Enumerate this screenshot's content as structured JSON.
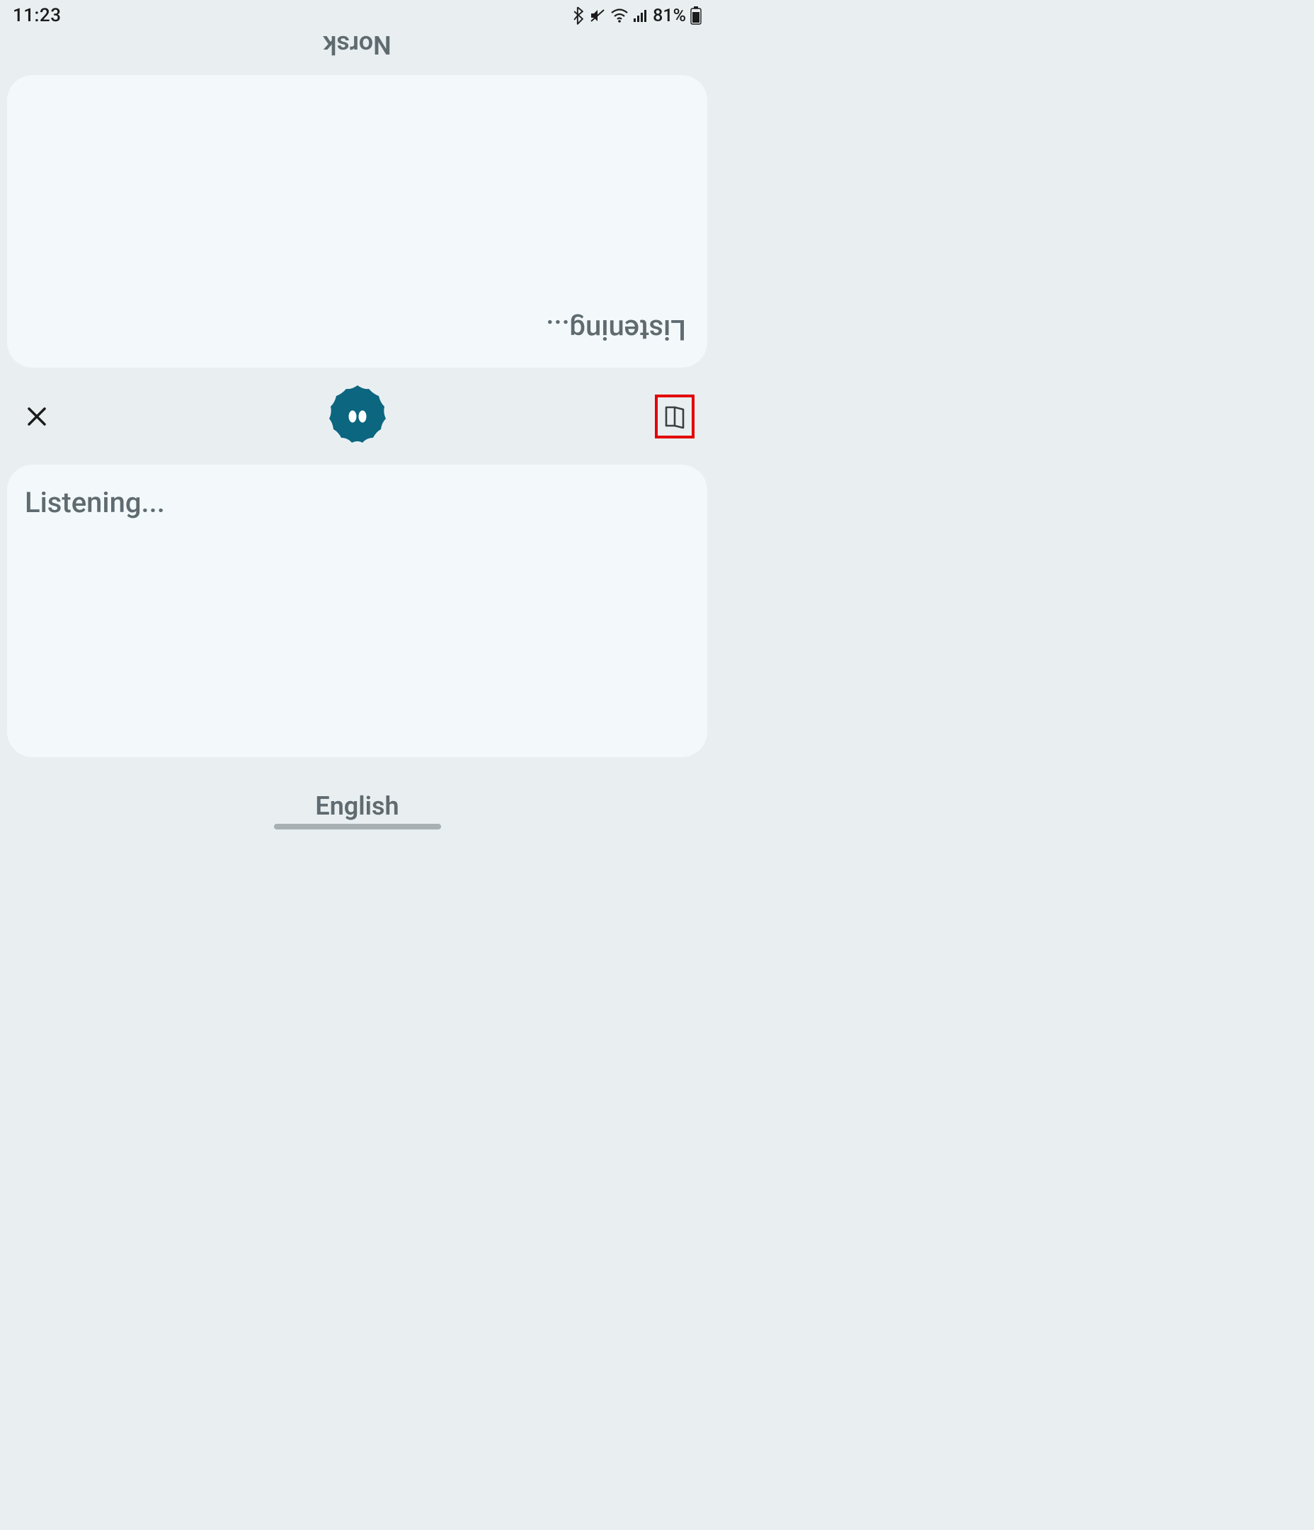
{
  "status": {
    "time": "11:23",
    "battery_text": "81%"
  },
  "top": {
    "language": "Norsk",
    "listening": "Listening..."
  },
  "bottom": {
    "language": "English",
    "listening": "Listening..."
  },
  "colors": {
    "badge": "#0c6680"
  }
}
